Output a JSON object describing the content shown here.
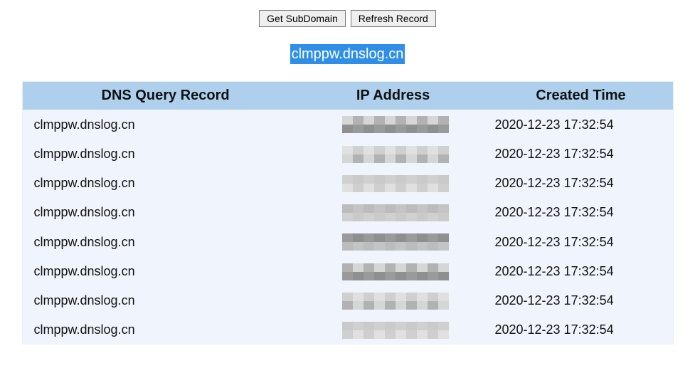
{
  "buttons": {
    "get_subdomain_label": "Get SubDomain",
    "refresh_record_label": "Refresh Record"
  },
  "subdomain": "clmppw.dnslog.cn",
  "colors": {
    "highlight": "#2f8fe6",
    "header_bg": "#aed0ec",
    "row_bg": "#f0f4fc"
  },
  "table": {
    "headers": {
      "dns": "DNS Query Record",
      "ip": "IP Address",
      "time": "Created Time"
    },
    "rows": [
      {
        "dns": "clmppw.dnslog.cn",
        "ip": "(redacted)",
        "time": "2020-12-23 17:32:54"
      },
      {
        "dns": "clmppw.dnslog.cn",
        "ip": "(redacted)",
        "time": "2020-12-23 17:32:54"
      },
      {
        "dns": "clmppw.dnslog.cn",
        "ip": "(redacted)",
        "time": "2020-12-23 17:32:54"
      },
      {
        "dns": "clmppw.dnslog.cn",
        "ip": "(redacted)",
        "time": "2020-12-23 17:32:54"
      },
      {
        "dns": "clmppw.dnslog.cn",
        "ip": "(redacted)",
        "time": "2020-12-23 17:32:54"
      },
      {
        "dns": "clmppw.dnslog.cn",
        "ip": "(redacted)",
        "time": "2020-12-23 17:32:54"
      },
      {
        "dns": "clmppw.dnslog.cn",
        "ip": "(redacted)",
        "time": "2020-12-23 17:32:54"
      },
      {
        "dns": "clmppw.dnslog.cn",
        "ip": "(redacted)",
        "time": "2020-12-23 17:32:54"
      }
    ]
  }
}
